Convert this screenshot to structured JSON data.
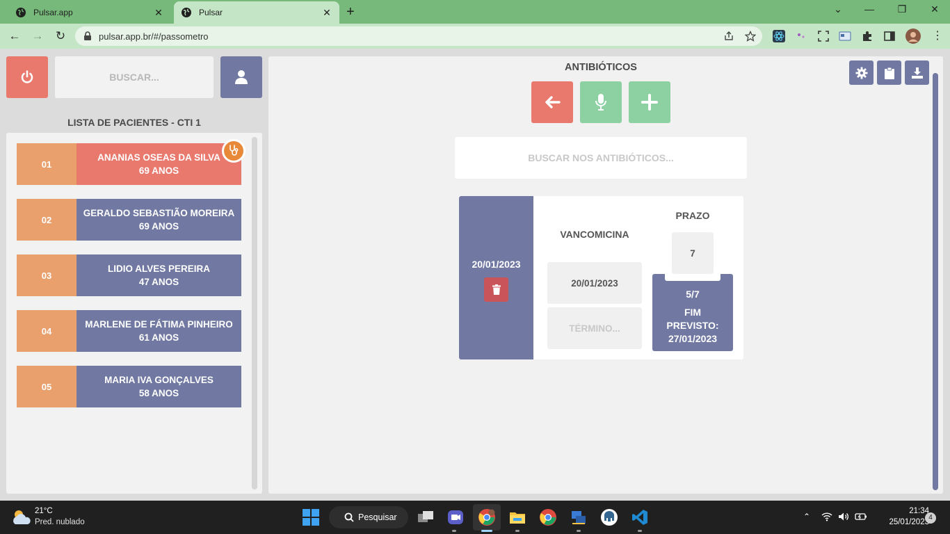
{
  "browser": {
    "tabs": [
      {
        "title": "Pulsar.app",
        "active": false
      },
      {
        "title": "Pulsar",
        "active": true
      }
    ],
    "url": "pulsar.app.br/#/passometro"
  },
  "sidebar": {
    "search_placeholder": "BUSCAR...",
    "list_title": "LISTA DE PACIENTES - CTI 1",
    "patients": [
      {
        "num": "01",
        "name": "ANANIAS OSEAS DA SILVA",
        "age": "69 ANOS",
        "alert": true
      },
      {
        "num": "02",
        "name": "GERALDO SEBASTIÃO MOREIRA",
        "age": "69 ANOS",
        "alert": false
      },
      {
        "num": "03",
        "name": "LIDIO ALVES PEREIRA",
        "age": "47 ANOS",
        "alert": false
      },
      {
        "num": "04",
        "name": "MARLENE DE FÁTIMA PINHEIRO",
        "age": "61 ANOS",
        "alert": false
      },
      {
        "num": "05",
        "name": "MARIA IVA GONÇALVES",
        "age": "58 ANOS",
        "alert": false
      }
    ]
  },
  "main": {
    "title": "ANTIBIÓTICOS",
    "search_placeholder": "BUSCAR NOS ANTIBIÓTICOS...",
    "entry": {
      "date": "20/01/2023",
      "drug": "VANCOMICINA",
      "start": "20/01/2023",
      "end_placeholder": "TÉRMINO...",
      "prazo_label": "PRAZO",
      "prazo": "7",
      "progress": "5/7",
      "end_label": "FIM PREVISTO:",
      "end_date": "27/01/2023"
    }
  },
  "taskbar": {
    "temperature": "21°C",
    "weather": "Pred. nublado",
    "search_label": "Pesquisar",
    "time": "21:34",
    "date": "25/01/2023",
    "notifications": "4"
  },
  "colors": {
    "coral": "#e9786d",
    "slate": "#7179a3",
    "orange": "#e9a06d",
    "green": "#8dd0a2",
    "trash_red": "#c9555a"
  }
}
